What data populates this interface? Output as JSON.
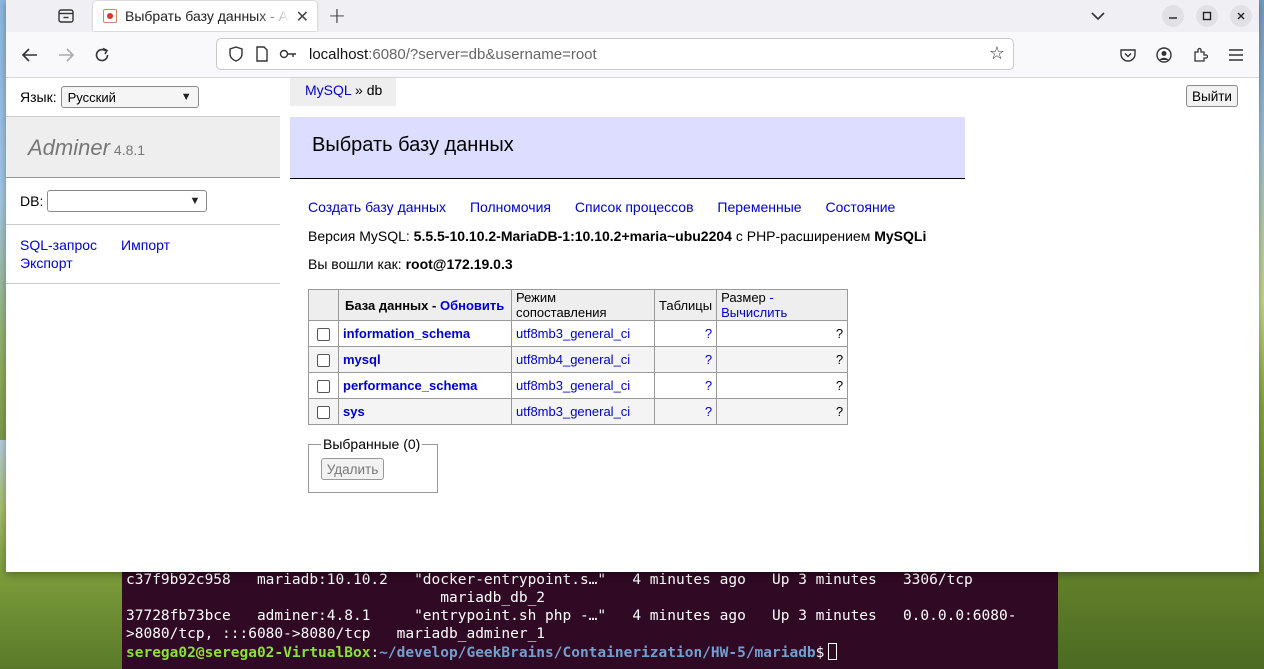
{
  "browser": {
    "tab_title": "Выбрать базу данных - Adminer",
    "url_host": "localhost",
    "url_rest": ":6080/?server=db&username=root"
  },
  "page": {
    "lang_label": "Язык:",
    "lang_value": "Русский",
    "logout": "Выйти",
    "brand_name": "Adminer",
    "brand_version": "4.8.1",
    "db_label": "DB:",
    "db_value": "",
    "sidebar_links": [
      "SQL-запрос",
      "Импорт",
      "Экспорт"
    ],
    "breadcrumb_link": "MySQL",
    "breadcrumb_rest": " » db",
    "heading": "Выбрать базу данных",
    "menu": [
      "Создать базу данных",
      "Полномочия",
      "Список процессов",
      "Переменные",
      "Состояние"
    ],
    "version_prefix": "Версия MySQL: ",
    "version_value": "5.5.5-10.10.2-MariaDB-1:10.10.2+maria~ubu2204",
    "version_middle": " с PHP-расширением ",
    "version_ext": "MySQLi",
    "logged_prefix": "Вы вошли как: ",
    "logged_value": "root@172.19.0.3",
    "table": {
      "col_db": "База данных",
      "col_db_sep": " - ",
      "col_refresh": "Обновить",
      "col_collation": "Режим сопоставления",
      "col_tables": "Таблицы",
      "col_size": "Размер",
      "col_size_sep": " - ",
      "col_compute": "Вычислить",
      "rows": [
        {
          "name": "information_schema",
          "collation": "utf8mb3_general_ci",
          "tables": "?",
          "size": "?"
        },
        {
          "name": "mysql",
          "collation": "utf8mb4_general_ci",
          "tables": "?",
          "size": "?"
        },
        {
          "name": "performance_schema",
          "collation": "utf8mb3_general_ci",
          "tables": "?",
          "size": "?"
        },
        {
          "name": "sys",
          "collation": "utf8mb3_general_ci",
          "tables": "?",
          "size": "?"
        }
      ]
    },
    "selected_legend": "Выбранные (0)",
    "delete_button": "Удалить"
  },
  "terminal": {
    "lines": [
      "c37f9b92c958   mariadb:10.10.2   \"docker-entrypoint.s…\"   4 minutes ago   Up 3 minutes   3306/tcp",
      "                                    mariadb_db_2",
      "37728fb73bce   adminer:4.8.1     \"entrypoint.sh php -…\"   4 minutes ago   Up 3 minutes   0.0.0.0:6080-",
      ">8080/tcp, :::6080->8080/tcp   mariadb_adminer_1"
    ],
    "prompt_user": "serega02@serega02-VirtualBox",
    "prompt_path": "~/develop/GeekBrains/Containerization/HW-5/mariadb",
    "prompt_symbol": "$"
  },
  "icons": [
    "tab-list-icon",
    "favicon-icon",
    "close-icon",
    "new-tab-icon",
    "chevron-down-icon",
    "minimize-icon",
    "maximize-icon",
    "window-close-icon",
    "back-icon",
    "forward-icon",
    "reload-icon",
    "shield-icon",
    "page-icon",
    "key-icon",
    "star-icon",
    "pocket-icon",
    "account-icon",
    "extensions-icon",
    "menu-icon"
  ]
}
